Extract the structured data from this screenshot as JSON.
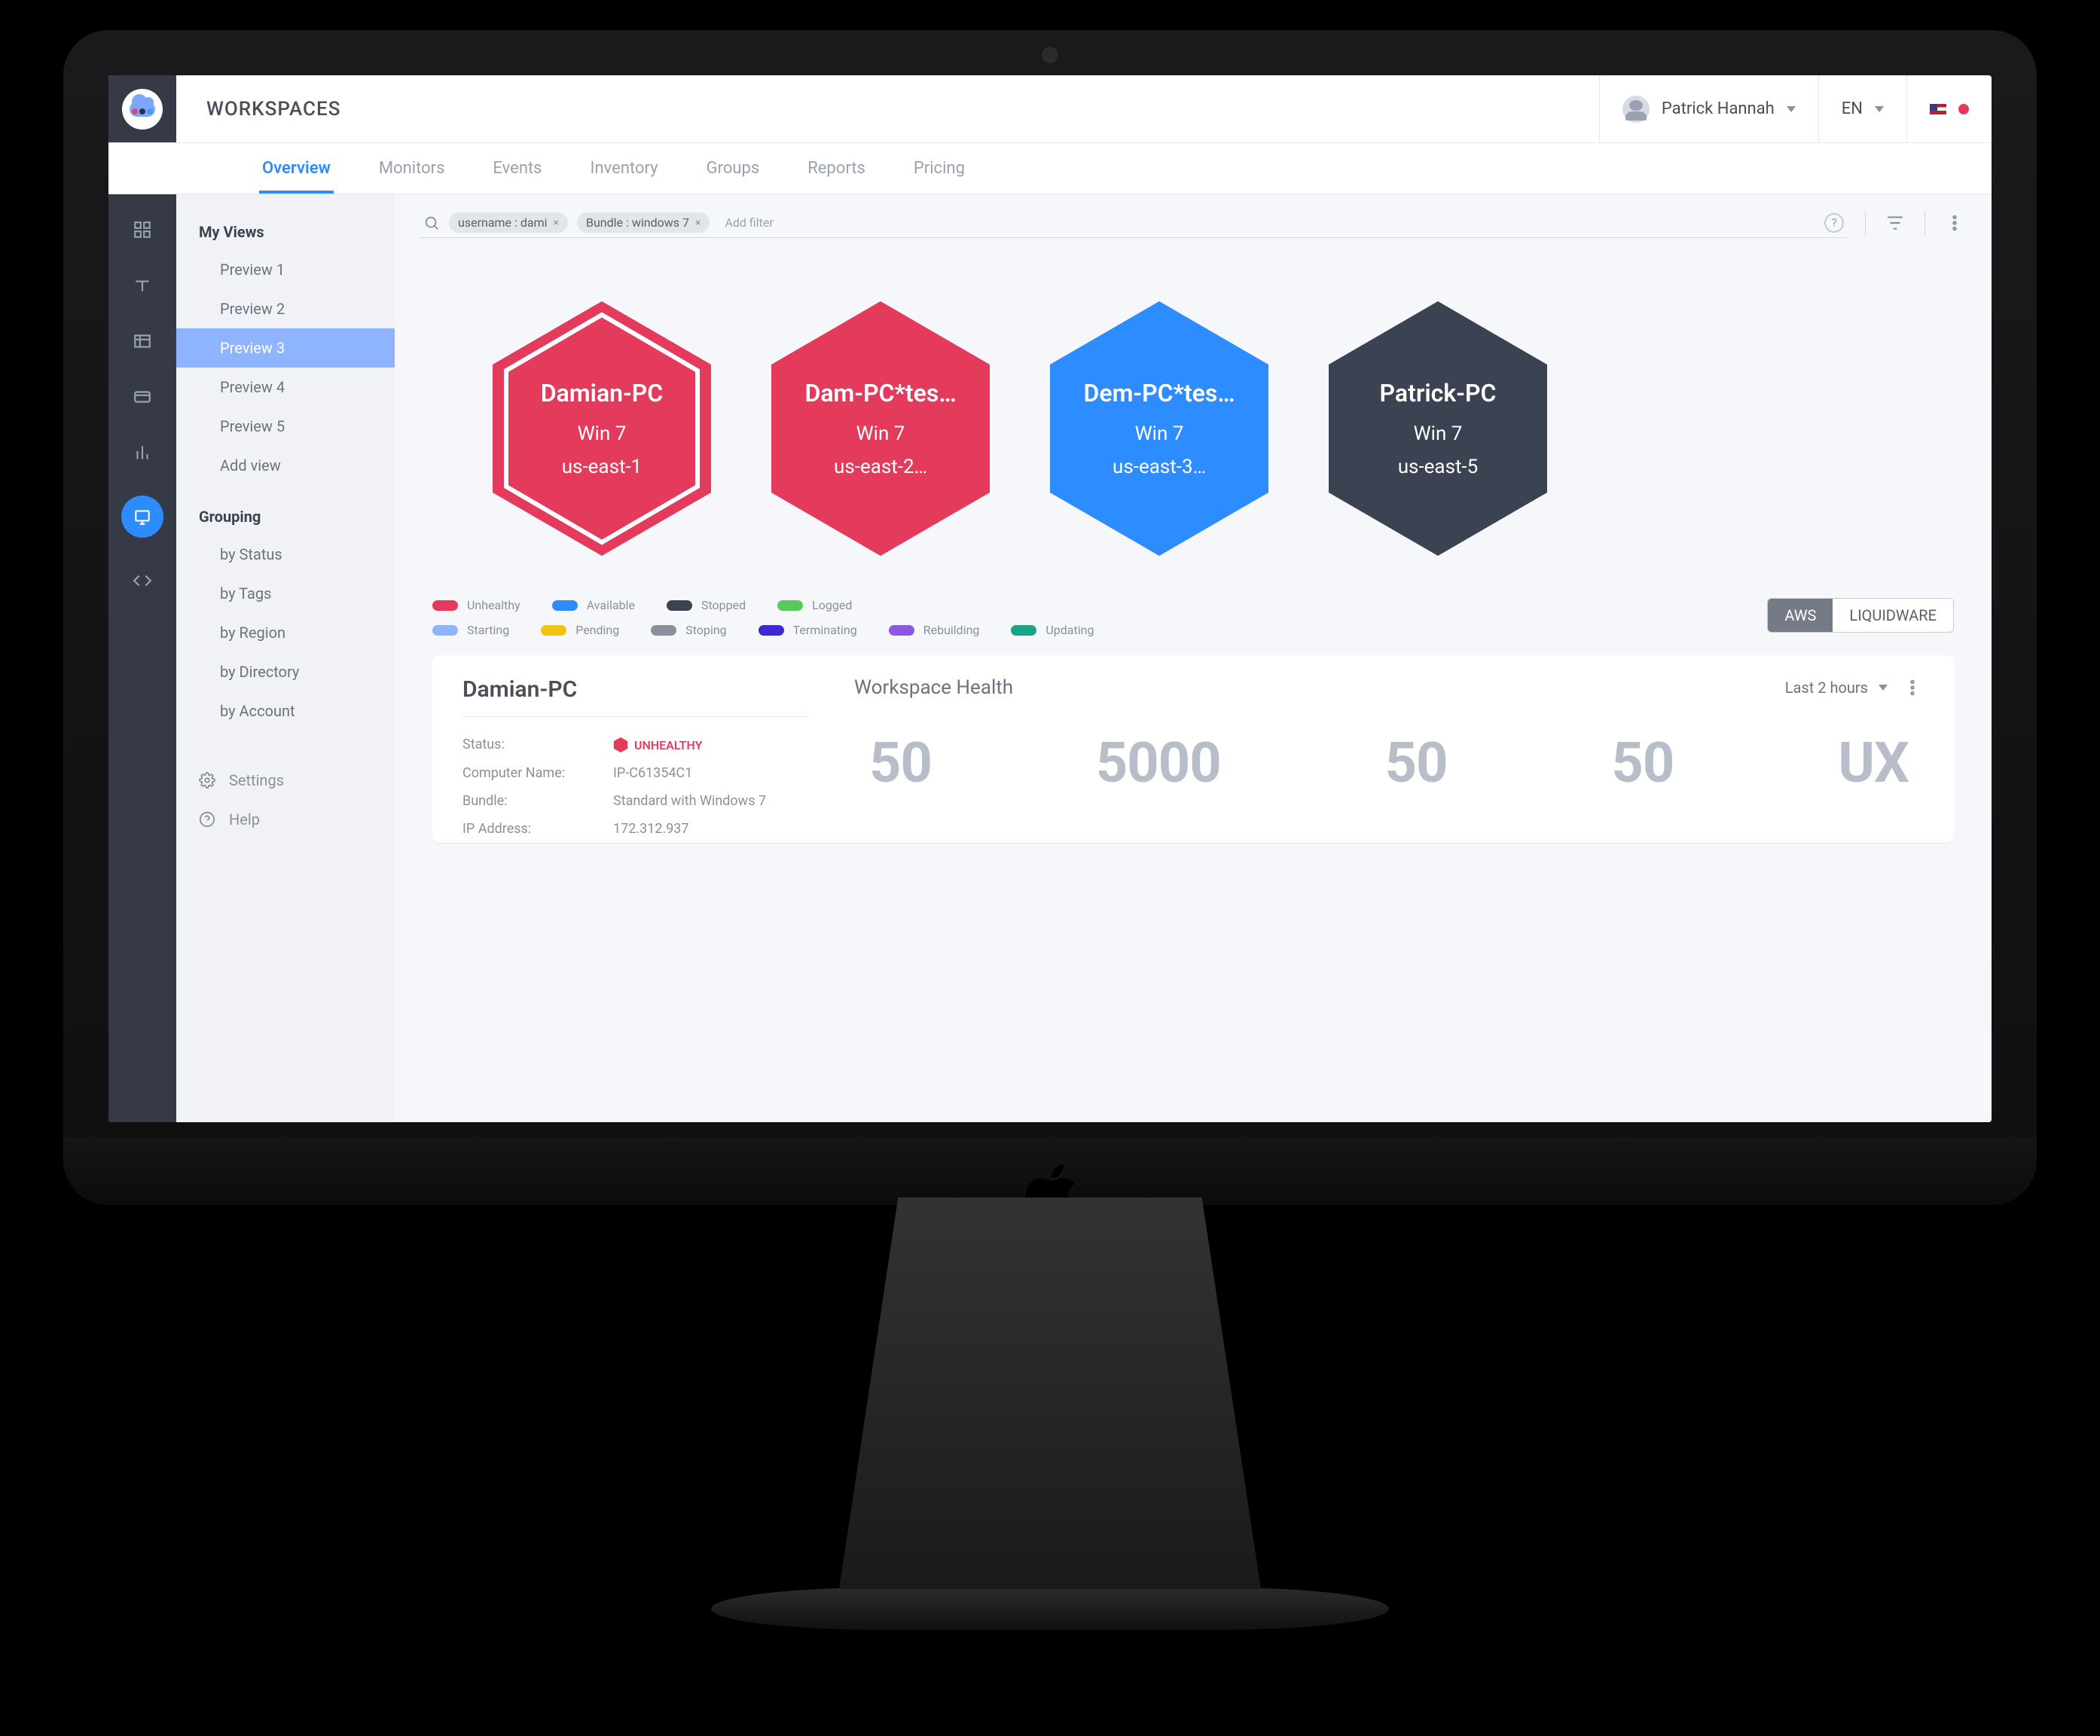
{
  "header": {
    "page_title": "WORKSPACES",
    "user_name": "Patrick Hannah",
    "language": "EN"
  },
  "tabs": {
    "items": [
      "Overview",
      "Monitors",
      "Events",
      "Inventory",
      "Groups",
      "Reports",
      "Pricing"
    ],
    "active": "Overview"
  },
  "filterbar": {
    "chips": [
      {
        "label": "username : dami"
      },
      {
        "label": "Bundle : windows 7"
      }
    ],
    "add_filter": "Add filter"
  },
  "sidebar": {
    "views_heading": "My Views",
    "views": [
      {
        "label": "Preview 1"
      },
      {
        "label": "Preview 2"
      },
      {
        "label": "Preview 3",
        "selected": true
      },
      {
        "label": "Preview 4"
      },
      {
        "label": "Preview 5"
      },
      {
        "label": "Add view"
      }
    ],
    "grouping_heading": "Grouping",
    "grouping": [
      {
        "label": "by Status"
      },
      {
        "label": "by Tags"
      },
      {
        "label": "by Region"
      },
      {
        "label": "by Directory"
      },
      {
        "label": "by Account"
      }
    ],
    "settings": "Settings",
    "help": "Help"
  },
  "hexes": [
    {
      "name": "Damian-PC",
      "os": "Win 7",
      "region": "us-east-1",
      "color": "#e43b5d",
      "selected": true
    },
    {
      "name": "Dam-PC*tes…",
      "os": "Win 7",
      "region": "us-east-2…",
      "color": "#e43b5d"
    },
    {
      "name": "Dem-PC*tes…",
      "os": "Win 7",
      "region": "us-east-3…",
      "color": "#2d8cff"
    },
    {
      "name": "Patrick-PC",
      "os": "Win 7",
      "region": "us-east-5",
      "color": "#3b4251"
    }
  ],
  "legend": {
    "row1": [
      {
        "label": "Unhealthy",
        "color": "#e43b5d"
      },
      {
        "label": "Available",
        "color": "#2d8cff"
      },
      {
        "label": "Stopped",
        "color": "#3b4251"
      },
      {
        "label": "Logged",
        "color": "#58c95a"
      }
    ],
    "row2": [
      {
        "label": "Starting",
        "color": "#8fb4ff"
      },
      {
        "label": "Pending",
        "color": "#f1c40f"
      },
      {
        "label": "Stoping",
        "color": "#8a909c"
      },
      {
        "label": "Terminating",
        "color": "#3b2bd1"
      },
      {
        "label": "Rebuilding",
        "color": "#8a59e0"
      },
      {
        "label": "Updating",
        "color": "#1ba38a"
      }
    ]
  },
  "toggle": {
    "left": "AWS",
    "right": "LIQUIDWARE"
  },
  "detail": {
    "title": "Damian-PC",
    "status_key": "Status:",
    "status_value": "UNHEALTHY",
    "computer_key": "Computer Name:",
    "computer_value": "IP-C61354C1",
    "bundle_key": "Bundle:",
    "bundle_value": "Standard with Windows 7",
    "ip_key": "IP Address:",
    "ip_value": "172.312.937",
    "health_title": "Workspace Health",
    "range": "Last 2 hours",
    "metrics": [
      "50",
      "5000",
      "50",
      "50",
      "UX"
    ]
  }
}
